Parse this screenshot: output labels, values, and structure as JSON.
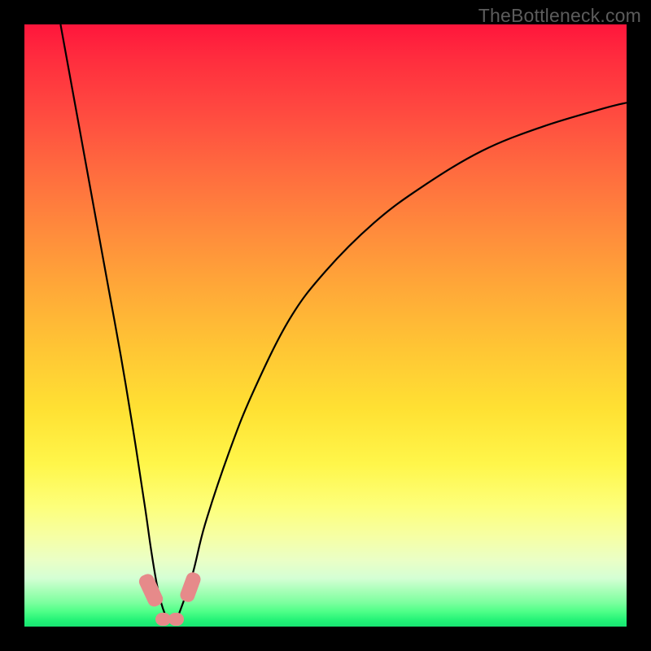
{
  "watermark": "TheBottleneck.com",
  "chart_data": {
    "type": "line",
    "title": "",
    "xlabel": "",
    "ylabel": "",
    "xlim": [
      0,
      100
    ],
    "ylim": [
      0,
      100
    ],
    "grid": false,
    "legend": false,
    "series": [
      {
        "name": "bottleneck-curve",
        "x": [
          6,
          8,
          10,
          12,
          14,
          16,
          18,
          20,
          21,
          22,
          23,
          24,
          25,
          26,
          28,
          30,
          34,
          38,
          44,
          50,
          58,
          66,
          76,
          86,
          96,
          100
        ],
        "y": [
          100,
          89,
          78,
          67,
          56,
          45,
          33,
          20,
          13,
          7,
          3,
          1,
          1,
          3,
          9,
          17,
          29,
          39,
          51,
          59,
          67,
          73,
          79,
          83,
          86,
          87
        ]
      }
    ],
    "markers": [
      {
        "name": "blob-left",
        "x": 21.0,
        "y": 6.0,
        "w": 2.5,
        "h": 5.5,
        "rot": -25
      },
      {
        "name": "blob-mid-a",
        "x": 23.0,
        "y": 1.2,
        "w": 2.6,
        "h": 2.2,
        "rot": 0
      },
      {
        "name": "blob-mid-b",
        "x": 25.2,
        "y": 1.2,
        "w": 2.6,
        "h": 2.2,
        "rot": 0
      },
      {
        "name": "blob-right",
        "x": 27.5,
        "y": 6.5,
        "w": 2.4,
        "h": 5.0,
        "rot": 20
      }
    ],
    "gradient_note": "vertical rainbow red→yellow→green, bottom = good"
  }
}
